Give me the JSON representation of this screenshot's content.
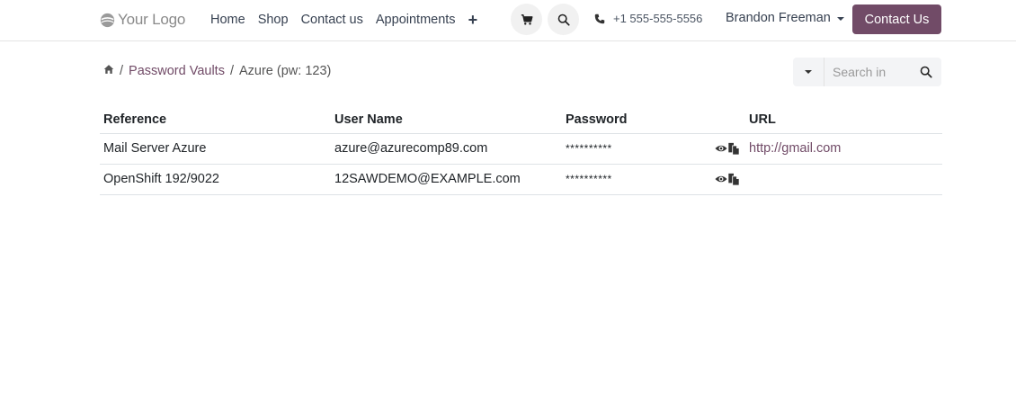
{
  "navbar": {
    "logo_text": "Your Logo",
    "menu": [
      {
        "label": "Home"
      },
      {
        "label": "Shop"
      },
      {
        "label": "Contact us"
      },
      {
        "label": "Appointments"
      }
    ],
    "plus_label": "+",
    "phone": "+1 555-555-5556",
    "user_name": "Brandon Freeman",
    "cta_label": "Contact Us"
  },
  "breadcrumb": {
    "separator": "/",
    "vaults_label": "Password Vaults",
    "current_label": "Azure (pw: 123)"
  },
  "search": {
    "placeholder": "Search in"
  },
  "table": {
    "headers": {
      "reference": "Reference",
      "user_name": "User Name",
      "password": "Password",
      "url": "URL"
    },
    "rows": [
      {
        "reference": "Mail Server Azure",
        "user_name": "azure@azurecomp89.com",
        "password": "**********",
        "url": "http://gmail.com"
      },
      {
        "reference": "OpenShift 192/9022",
        "user_name": "12SAWDEMO@EXAMPLE.com",
        "password": "**********",
        "url": ""
      }
    ]
  },
  "colors": {
    "brand": "#714b67",
    "text": "#212529",
    "border": "#dee2e6"
  }
}
